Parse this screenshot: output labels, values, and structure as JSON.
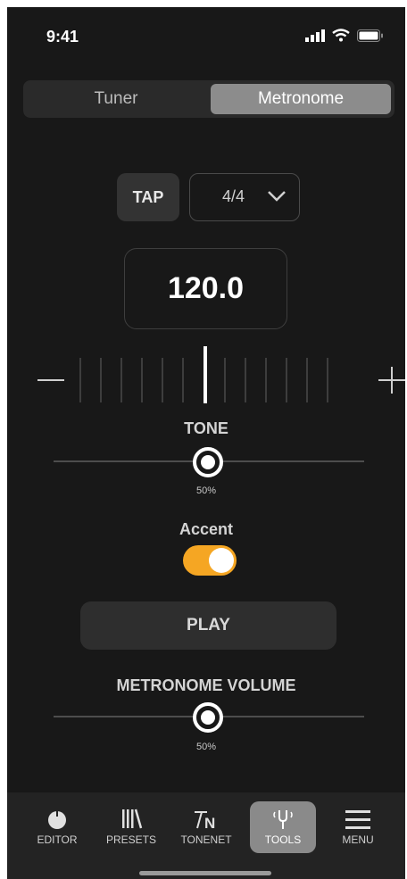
{
  "status_bar": {
    "time": "9:41"
  },
  "segmented": {
    "tabs": [
      "Tuner",
      "Metronome"
    ],
    "active": "Metronome"
  },
  "controls": {
    "tap_label": "TAP",
    "time_signature": "4/4",
    "tempo": "120.0"
  },
  "tone": {
    "label": "TONE",
    "value_percent": 50,
    "value_text": "50%"
  },
  "accent": {
    "label": "Accent",
    "enabled": true,
    "color": "#f5a623"
  },
  "play": {
    "label": "PLAY"
  },
  "volume": {
    "label": "METRONOME VOLUME",
    "value_percent": 50,
    "value_text": "50%"
  },
  "tabbar": {
    "items": [
      {
        "label": "EDITOR",
        "icon": "knob-icon"
      },
      {
        "label": "PRESETS",
        "icon": "presets-icon"
      },
      {
        "label": "TONENET",
        "icon": "tonenet-icon"
      },
      {
        "label": "TOOLS",
        "icon": "tuning-fork-icon"
      },
      {
        "label": "MENU",
        "icon": "hamburger-icon"
      }
    ],
    "active": "TOOLS"
  }
}
